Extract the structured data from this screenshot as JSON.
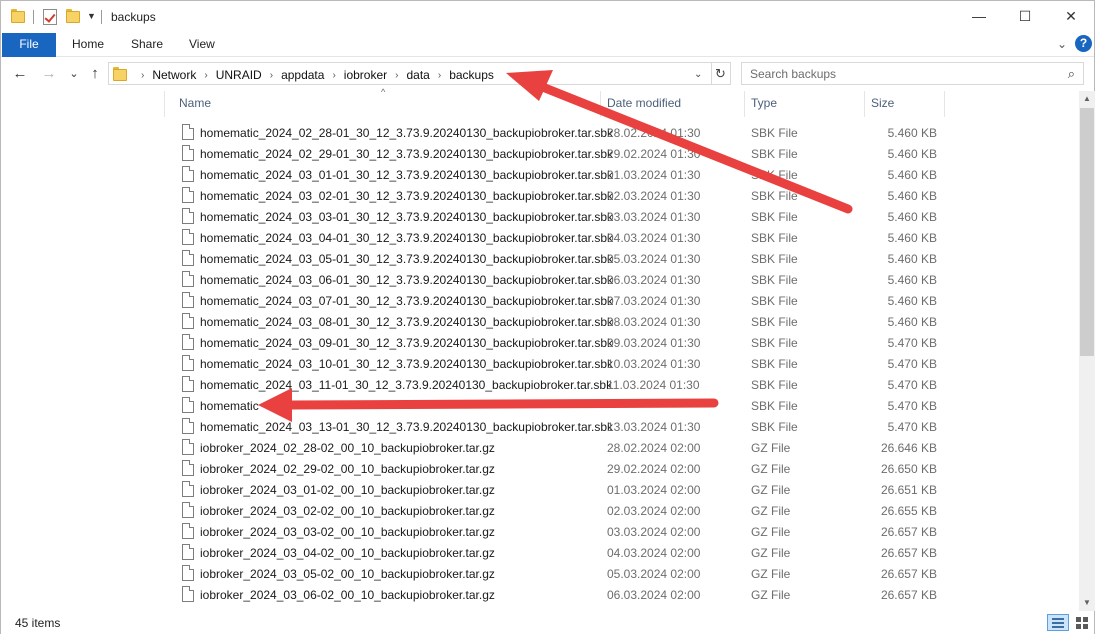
{
  "window": {
    "title": "backups",
    "controls": {
      "minimize": "—",
      "maximize": "☐",
      "close": "✕"
    }
  },
  "ribbon": {
    "tabs": [
      "File",
      "Home",
      "Share",
      "View"
    ],
    "expand_glyph": "⌄",
    "help_glyph": "?"
  },
  "nav": {
    "back": "←",
    "forward": "→",
    "recent": "⌄",
    "up": "↑"
  },
  "address": {
    "crumbs": [
      "Network",
      "UNRAID",
      "appdata",
      "iobroker",
      "data",
      "backups"
    ],
    "separator": "›",
    "dropdown_glyph": "⌄",
    "refresh_glyph": "↻"
  },
  "search": {
    "placeholder": "Search backups",
    "icon_glyph": "⌕"
  },
  "columns": {
    "name": "Name",
    "date": "Date modified",
    "type": "Type",
    "size": "Size",
    "sort_glyph": "^"
  },
  "files": [
    {
      "name": "homematic_2024_02_28-01_30_12_3.73.9.20240130_backupiobroker.tar.sbk",
      "date": "28.02.2024 01:30",
      "type": "SBK File",
      "size": "5.460 KB"
    },
    {
      "name": "homematic_2024_02_29-01_30_12_3.73.9.20240130_backupiobroker.tar.sbk",
      "date": "29.02.2024 01:30",
      "type": "SBK File",
      "size": "5.460 KB"
    },
    {
      "name": "homematic_2024_03_01-01_30_12_3.73.9.20240130_backupiobroker.tar.sbk",
      "date": "01.03.2024 01:30",
      "type": "SBK File",
      "size": "5.460 KB"
    },
    {
      "name": "homematic_2024_03_02-01_30_12_3.73.9.20240130_backupiobroker.tar.sbk",
      "date": "02.03.2024 01:30",
      "type": "SBK File",
      "size": "5.460 KB"
    },
    {
      "name": "homematic_2024_03_03-01_30_12_3.73.9.20240130_backupiobroker.tar.sbk",
      "date": "03.03.2024 01:30",
      "type": "SBK File",
      "size": "5.460 KB"
    },
    {
      "name": "homematic_2024_03_04-01_30_12_3.73.9.20240130_backupiobroker.tar.sbk",
      "date": "04.03.2024 01:30",
      "type": "SBK File",
      "size": "5.460 KB"
    },
    {
      "name": "homematic_2024_03_05-01_30_12_3.73.9.20240130_backupiobroker.tar.sbk",
      "date": "05.03.2024 01:30",
      "type": "SBK File",
      "size": "5.460 KB"
    },
    {
      "name": "homematic_2024_03_06-01_30_12_3.73.9.20240130_backupiobroker.tar.sbk",
      "date": "06.03.2024 01:30",
      "type": "SBK File",
      "size": "5.460 KB"
    },
    {
      "name": "homematic_2024_03_07-01_30_12_3.73.9.20240130_backupiobroker.tar.sbk",
      "date": "07.03.2024 01:30",
      "type": "SBK File",
      "size": "5.460 KB"
    },
    {
      "name": "homematic_2024_03_08-01_30_12_3.73.9.20240130_backupiobroker.tar.sbk",
      "date": "08.03.2024 01:30",
      "type": "SBK File",
      "size": "5.460 KB"
    },
    {
      "name": "homematic_2024_03_09-01_30_12_3.73.9.20240130_backupiobroker.tar.sbk",
      "date": "09.03.2024 01:30",
      "type": "SBK File",
      "size": "5.470 KB"
    },
    {
      "name": "homematic_2024_03_10-01_30_12_3.73.9.20240130_backupiobroker.tar.sbk",
      "date": "10.03.2024 01:30",
      "type": "SBK File",
      "size": "5.470 KB"
    },
    {
      "name": "homematic_2024_03_11-01_30_12_3.73.9.20240130_backupiobroker.tar.sbk",
      "date": "11.03.2024 01:30",
      "type": "SBK File",
      "size": "5.470 KB"
    },
    {
      "name": "homematic",
      "date": "",
      "type": "SBK File",
      "size": "5.470 KB"
    },
    {
      "name": "homematic_2024_03_13-01_30_12_3.73.9.20240130_backupiobroker.tar.sbk",
      "date": "13.03.2024 01:30",
      "type": "SBK File",
      "size": "5.470 KB"
    },
    {
      "name": "iobroker_2024_02_28-02_00_10_backupiobroker.tar.gz",
      "date": "28.02.2024 02:00",
      "type": "GZ File",
      "size": "26.646 KB"
    },
    {
      "name": "iobroker_2024_02_29-02_00_10_backupiobroker.tar.gz",
      "date": "29.02.2024 02:00",
      "type": "GZ File",
      "size": "26.650 KB"
    },
    {
      "name": "iobroker_2024_03_01-02_00_10_backupiobroker.tar.gz",
      "date": "01.03.2024 02:00",
      "type": "GZ File",
      "size": "26.651 KB"
    },
    {
      "name": "iobroker_2024_03_02-02_00_10_backupiobroker.tar.gz",
      "date": "02.03.2024 02:00",
      "type": "GZ File",
      "size": "26.655 KB"
    },
    {
      "name": "iobroker_2024_03_03-02_00_10_backupiobroker.tar.gz",
      "date": "03.03.2024 02:00",
      "type": "GZ File",
      "size": "26.657 KB"
    },
    {
      "name": "iobroker_2024_03_04-02_00_10_backupiobroker.tar.gz",
      "date": "04.03.2024 02:00",
      "type": "GZ File",
      "size": "26.657 KB"
    },
    {
      "name": "iobroker_2024_03_05-02_00_10_backupiobroker.tar.gz",
      "date": "05.03.2024 02:00",
      "type": "GZ File",
      "size": "26.657 KB"
    },
    {
      "name": "iobroker_2024_03_06-02_00_10_backupiobroker.tar.gz",
      "date": "06.03.2024 02:00",
      "type": "GZ File",
      "size": "26.657 KB"
    }
  ],
  "status": {
    "item_count": "45 items"
  },
  "colors": {
    "accent": "#1966c0",
    "annotation_arrow": "#e8413f",
    "header_text": "#4c607a"
  }
}
